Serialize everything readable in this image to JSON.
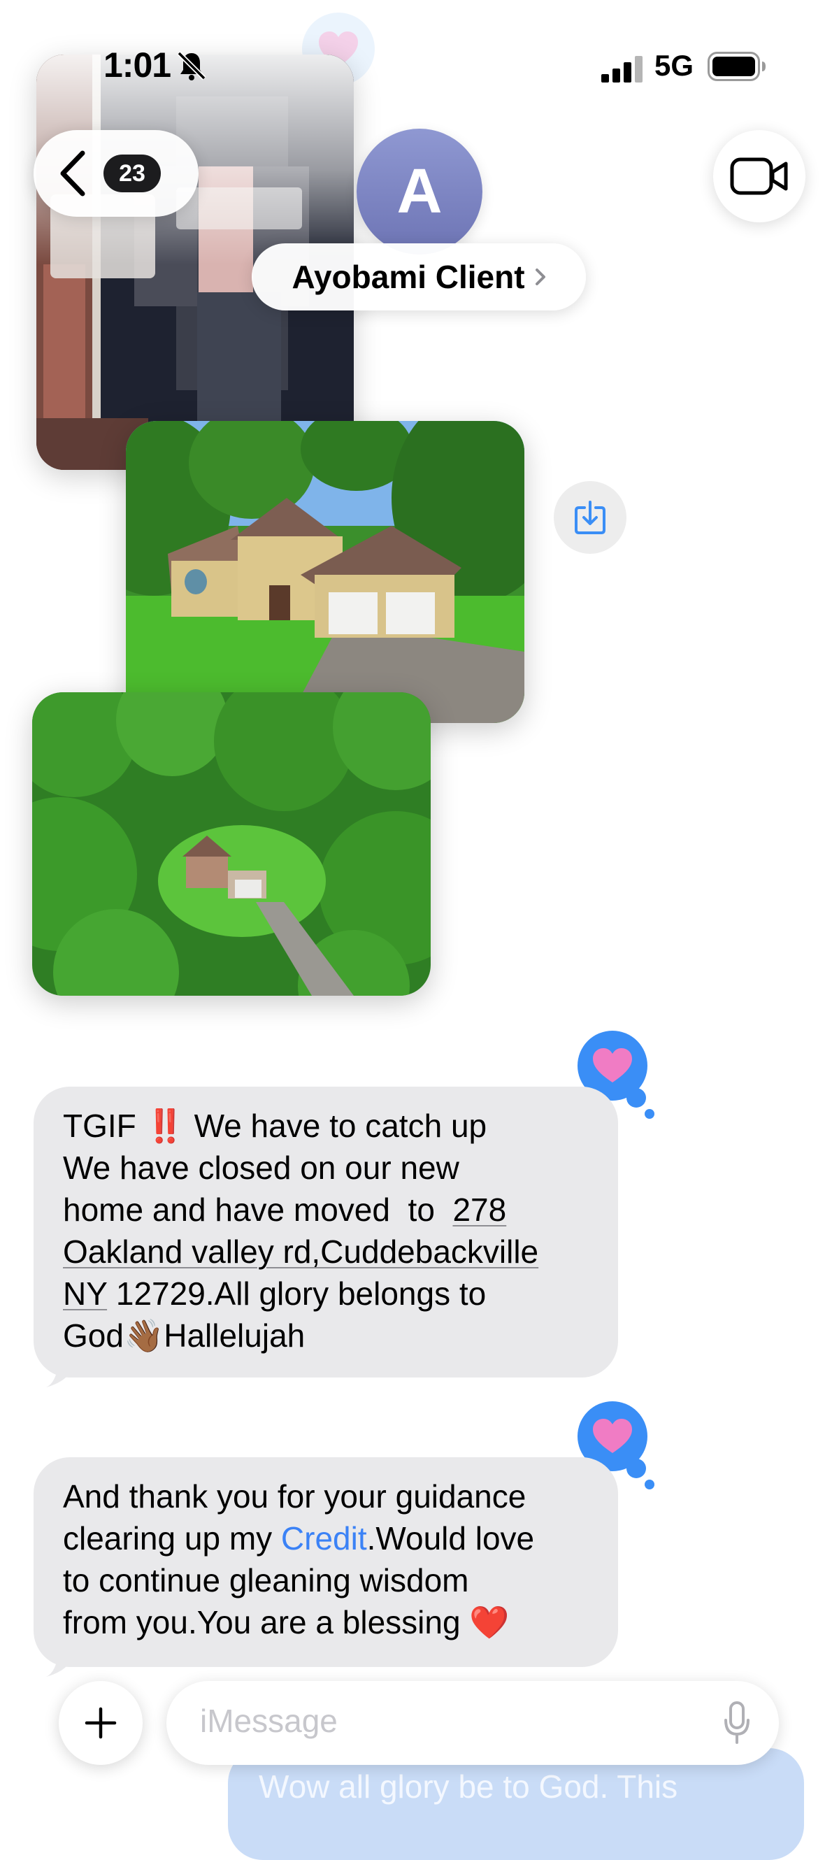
{
  "status_bar": {
    "time": "1:01",
    "network": "5G"
  },
  "header": {
    "back_count": "23",
    "avatar_initial": "A",
    "contact_name": "Ayobami Client"
  },
  "messages": [
    {
      "lines": [
        "TGIF ‼️ We have to catch up",
        "We have closed on our new",
        "home and have moved  to  ",
        "278",
        "Oakland valley rd,Cuddebackville",
        "NY",
        " 12729.All glory belongs to",
        "God👋🏾Hallelujah"
      ],
      "reaction": "heart"
    },
    {
      "lines": [
        "And thank you for your guidance",
        "clearing up my ",
        "Credit",
        ".Would love",
        "to continue gleaning wisdom",
        "from you.You are a blessing ❤️"
      ],
      "reaction": "heart"
    }
  ],
  "composer": {
    "placeholder": "iMessage",
    "outgoing_preview": "Wow all glory be to God. This"
  },
  "colors": {
    "accent": "#3a8ef6",
    "bubble_gray": "#e9e9eb",
    "avatar": "#7c84c4",
    "heart_pink": "#f07cc4"
  },
  "icons": [
    "bell-slash-icon",
    "signal-icon",
    "battery-icon",
    "chevron-left-icon",
    "video-camera-icon",
    "save-download-icon",
    "heart-icon",
    "plus-icon",
    "microphone-icon"
  ]
}
